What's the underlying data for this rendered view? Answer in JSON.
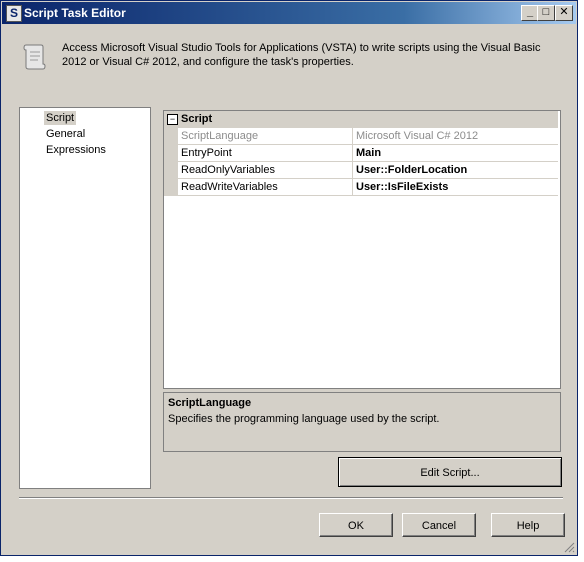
{
  "window": {
    "title": "Script Task Editor",
    "minimize": "_",
    "maximize": "□",
    "close": "✕"
  },
  "header": {
    "icon": "script-scroll-icon",
    "description": "Access Microsoft Visual Studio Tools for Applications (VSTA) to write scripts using the Visual Basic 2012 or Visual C# 2012, and configure the task's properties."
  },
  "nav": {
    "items": [
      {
        "label": "Script",
        "selected": true
      },
      {
        "label": "General",
        "selected": false
      },
      {
        "label": "Expressions",
        "selected": false
      }
    ]
  },
  "property_grid": {
    "category": "Script",
    "toggle": "⊟",
    "properties": [
      {
        "name": "ScriptLanguage",
        "value": "Microsoft Visual C# 2012",
        "disabled": true
      },
      {
        "name": "EntryPoint",
        "value": "Main",
        "disabled": false
      },
      {
        "name": "ReadOnlyVariables",
        "value": "User::FolderLocation",
        "disabled": false
      },
      {
        "name": "ReadWriteVariables",
        "value": "User::IsFileExists",
        "disabled": false
      }
    ]
  },
  "description": {
    "title": "ScriptLanguage",
    "text": "Specifies the programming language used by the script."
  },
  "buttons": {
    "edit_script": "Edit Script...",
    "ok": "OK",
    "cancel": "Cancel",
    "help": "Help"
  },
  "colors": {
    "titlebar_start": "#0a246a",
    "titlebar_end": "#a6caf0",
    "dialog_face": "#d4d0c8",
    "disabled_text": "#8c8c8c"
  }
}
